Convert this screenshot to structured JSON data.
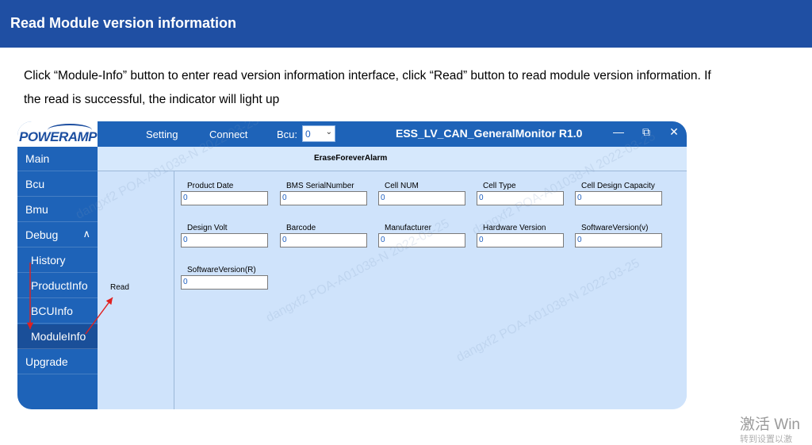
{
  "doc": {
    "title": "Read Module version information",
    "line1": "Click “Module-Info” button to enter read version information interface, click “Read” button to read module version information. If",
    "line2": "the read is successful, the indicator will light up"
  },
  "app": {
    "logo": "POWERAMP",
    "menu": {
      "setting": "Setting",
      "connect": "Connect",
      "bcu_label": "Bcu:",
      "bcu_value": "0"
    },
    "title": "ESS_LV_CAN_GeneralMonitor R1.0",
    "window_buttons": {
      "minimize": "—",
      "maximize": "⧉",
      "close": "✕"
    }
  },
  "sidebar": {
    "items": [
      {
        "label": "Main"
      },
      {
        "label": "Bcu"
      },
      {
        "label": "Bmu"
      },
      {
        "label": "Debug"
      },
      {
        "label": "History"
      },
      {
        "label": "ProductInfo"
      },
      {
        "label": "BCUInfo"
      },
      {
        "label": "ModuleInfo"
      },
      {
        "label": "Upgrade"
      }
    ],
    "debug_chevron": "∧"
  },
  "toolbar": {
    "erase_label": "EraseForeverAlarm"
  },
  "panel": {
    "read_label": "Read",
    "fields": [
      {
        "label": "Product Date",
        "value": "0"
      },
      {
        "label": "BMS SerialNumber",
        "value": "0"
      },
      {
        "label": "Cell NUM",
        "value": "0"
      },
      {
        "label": "Cell Type",
        "value": "0"
      },
      {
        "label": "Cell Design Capacity",
        "value": "0"
      },
      {
        "label": "Design Volt",
        "value": "0"
      },
      {
        "label": "Barcode",
        "value": "0"
      },
      {
        "label": "Manufacturer",
        "value": "0"
      },
      {
        "label": "Hardware Version",
        "value": "0"
      },
      {
        "label": "SoftwareVersion(v)",
        "value": "0"
      },
      {
        "label": "SoftwareVersion(R)",
        "value": "0"
      }
    ]
  },
  "watermark": {
    "text": "dangxf2 POA-A01038-N 2022-03-25"
  },
  "os_overlay": {
    "line1": "激活 Win",
    "line2": "转到设置以激"
  },
  "colors": {
    "header": "#1f4fa3",
    "sidebar": "#1e63b8",
    "content": "#cfe3fb",
    "arrow": "#e02020"
  }
}
